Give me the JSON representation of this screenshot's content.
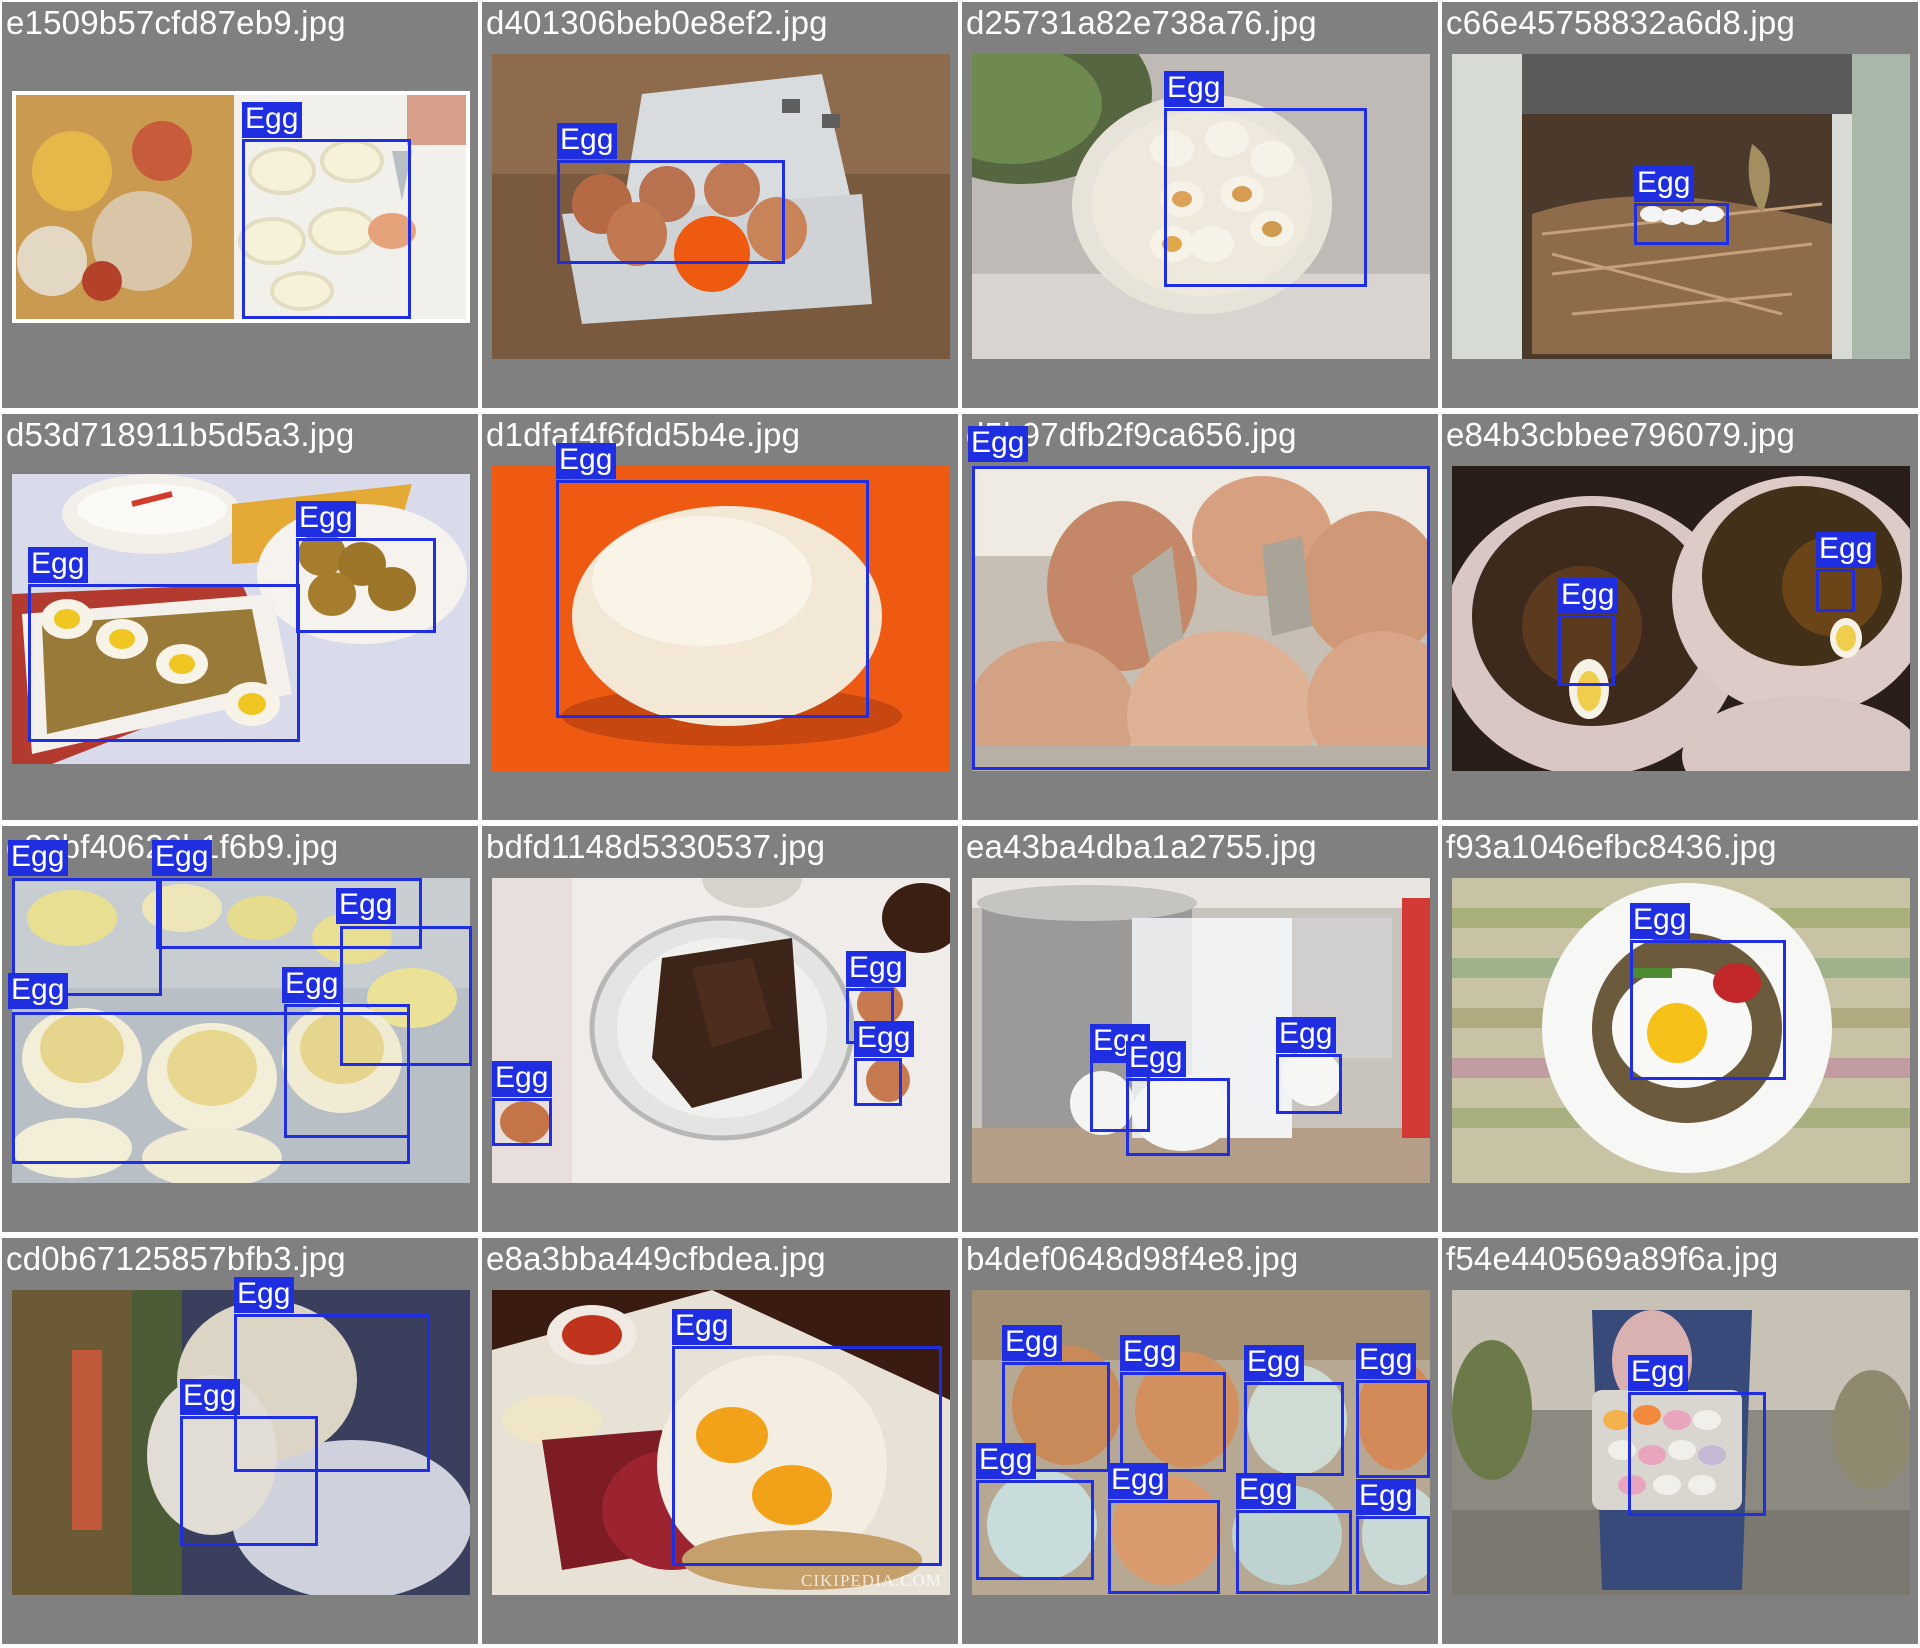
{
  "app": {
    "title": "Egg detection validation batch"
  },
  "theme": {
    "cell_background": "#808080",
    "box_color": "#1f2ee0",
    "label_text_color": "#ffffff",
    "title_text_color": "#ffffff"
  },
  "grid": {
    "cells": [
      {
        "filename": "e1509b57cfd87eb9.jpg",
        "scene": "deviled-eggs-piping",
        "detections": [
          {
            "label": "Egg"
          }
        ]
      },
      {
        "filename": "d401306beb0e8ef2.jpg",
        "scene": "eggs-in-carton-with-orange",
        "detections": [
          {
            "label": "Egg"
          }
        ]
      },
      {
        "filename": "d25731a82e738a76.jpg",
        "scene": "boiled-eggs-plate",
        "detections": [
          {
            "label": "Egg"
          }
        ]
      },
      {
        "filename": "c66e45758832a6d8.jpg",
        "scene": "bird-nest-box",
        "detections": [
          {
            "label": "Egg"
          }
        ]
      },
      {
        "filename": "d53d718911b5d5a3.jpg",
        "scene": "egg-curry-rice",
        "detections": [
          {
            "label": "Egg"
          },
          {
            "label": "Egg"
          }
        ]
      },
      {
        "filename": "d1dfaf4f6fdd5b4e.jpg",
        "scene": "large-white-egg-orange-bg",
        "detections": [
          {
            "label": "Egg"
          }
        ]
      },
      {
        "filename": "d5b97dfb2f9ca656.jpg",
        "scene": "brown-eggs-carton-closeup",
        "detections": [
          {
            "label": "Egg"
          }
        ]
      },
      {
        "filename": "e84b3cbbee796079.jpg",
        "scene": "noodle-cups-eggs",
        "detections": [
          {
            "label": "Egg"
          },
          {
            "label": "Egg"
          }
        ]
      },
      {
        "filename": "e32bf40626b1f6b9.jpg",
        "scene": "deviled-eggs-tray",
        "detections": [
          {
            "label": "Egg"
          },
          {
            "label": "Egg"
          },
          {
            "label": "Egg"
          },
          {
            "label": "Egg"
          },
          {
            "label": "Egg"
          }
        ]
      },
      {
        "filename": "bdfd1148d5330537.jpg",
        "scene": "chocolate-bowl-eggs",
        "detections": [
          {
            "label": "Egg"
          },
          {
            "label": "Egg"
          },
          {
            "label": "Egg"
          }
        ]
      },
      {
        "filename": "ea43ba4dba1a2755.jpg",
        "scene": "baking-setup-eggs",
        "detections": [
          {
            "label": "Egg"
          },
          {
            "label": "Egg"
          },
          {
            "label": "Egg"
          }
        ]
      },
      {
        "filename": "f93a1046efbc8436.jpg",
        "scene": "fried-egg-bowl",
        "detections": [
          {
            "label": "Egg"
          }
        ]
      },
      {
        "filename": "cd0b67125857bfb3.jpg",
        "scene": "eggs-in-hands",
        "detections": [
          {
            "label": "Egg"
          },
          {
            "label": "Egg"
          }
        ]
      },
      {
        "filename": "e8a3bba449cfbdea.jpg",
        "scene": "fried-eggs-breakfast",
        "watermark": "CIKIPEDIA.COM",
        "detections": [
          {
            "label": "Egg"
          }
        ]
      },
      {
        "filename": "b4def0648d98f4e8.jpg",
        "scene": "mixed-eggs-carton",
        "detections": [
          {
            "label": "Egg"
          },
          {
            "label": "Egg"
          },
          {
            "label": "Egg"
          },
          {
            "label": "Egg"
          },
          {
            "label": "Egg"
          },
          {
            "label": "Egg"
          },
          {
            "label": "Egg"
          },
          {
            "label": "Egg"
          }
        ]
      },
      {
        "filename": "f54e440569a89f6a.jpg",
        "scene": "candy-eggs-jar",
        "detections": [
          {
            "label": "Egg"
          }
        ]
      }
    ]
  }
}
